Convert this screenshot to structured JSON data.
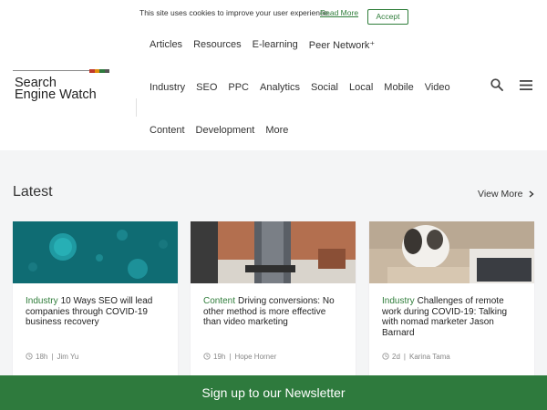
{
  "cookie": {
    "text": "This site uses cookies to improve your user experience.",
    "link": "Read More",
    "accept": "Accept"
  },
  "logo": {
    "line1": "Search",
    "line2": "Engine Watch"
  },
  "nav": {
    "row1": [
      "Articles",
      "Resources",
      "E-learning",
      "Peer Network⁺"
    ],
    "row2": [
      "Industry",
      "SEO",
      "PPC",
      "Analytics",
      "Social",
      "Local",
      "Mobile",
      "Video"
    ],
    "row3": [
      "Content",
      "Development",
      "More"
    ]
  },
  "icons": {
    "search": "search-icon",
    "menu": "hamburger-menu-icon",
    "clock": "clock-icon",
    "chevron": "chevron-right-icon"
  },
  "latest": {
    "title": "Latest",
    "view_more": "View More"
  },
  "cards": [
    {
      "category": "Industry",
      "title": "10 Ways SEO will lead companies through COVID-19 business recovery",
      "time": "18h",
      "author": "Jim Yu"
    },
    {
      "category": "Content",
      "title": "Driving conversions: No other method is more effective than video marketing",
      "time": "19h",
      "author": "Hope Horner"
    },
    {
      "category": "Industry",
      "title": "Challenges of remote work during COVID-19: Talking with nomad marketer Jason Barnard",
      "time": "2d",
      "author": "Karina Tama"
    }
  ],
  "newsletter": {
    "label": "Sign up to our Newsletter"
  },
  "colors": {
    "brand_green": "#2e7a3d",
    "link_green": "#2f7d3a"
  }
}
